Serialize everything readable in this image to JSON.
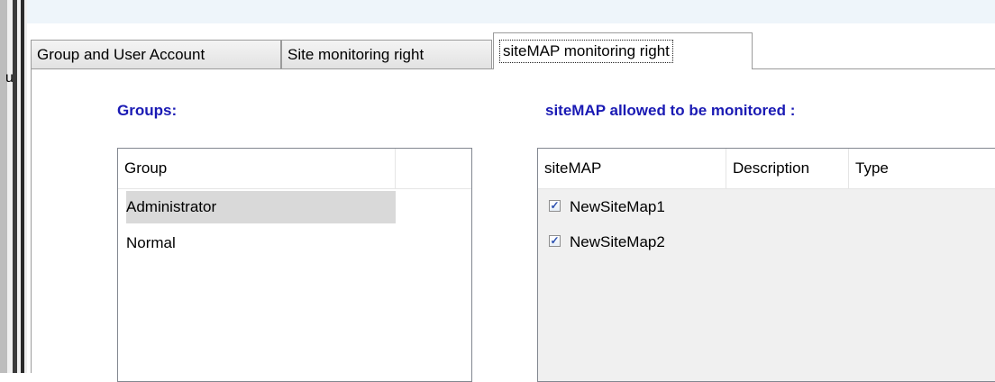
{
  "tabs": [
    {
      "label": "Group and User Account"
    },
    {
      "label": "Site monitoring right"
    },
    {
      "label": "siteMAP monitoring right"
    }
  ],
  "left_edge_glyph": "u",
  "groups": {
    "label": "Groups:",
    "column": "Group",
    "items": [
      "Administrator",
      "Normal"
    ],
    "selected": "Administrator"
  },
  "sitemaps": {
    "label": "siteMAP allowed to be monitored :",
    "columns": [
      "siteMAP",
      "Description",
      "Type"
    ],
    "items": [
      {
        "name": "NewSiteMap1",
        "checked": true
      },
      {
        "name": "NewSiteMap2",
        "checked": true
      }
    ]
  },
  "colors": {
    "section_label": "#1a1ab4",
    "selected_row": "#d9d9d9",
    "check_mark": "#2a4fb0"
  },
  "icons": {
    "checkbox_checked": "check-mark-icon"
  }
}
